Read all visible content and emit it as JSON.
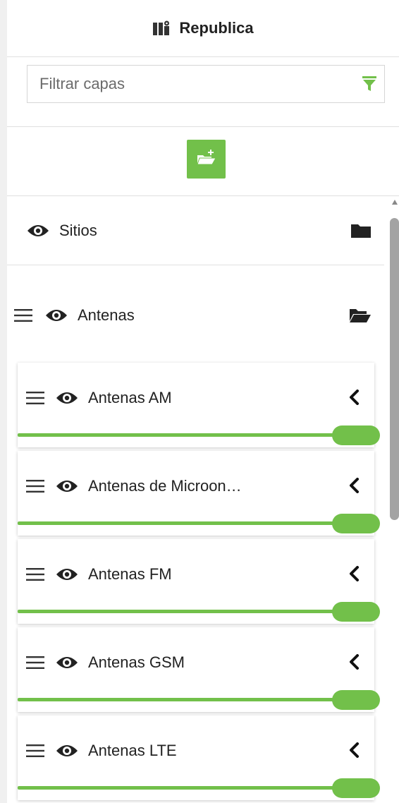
{
  "header": {
    "title": "Republica",
    "icon": "map-icon"
  },
  "filter": {
    "placeholder": "Filtrar capas",
    "icon": "filter-funnel-icon",
    "accent": "#72c04a"
  },
  "add_group": {
    "icon": "folder-plus-icon",
    "color": "#72c04a"
  },
  "groups": [
    {
      "label": "Sitios",
      "icon": "folder-closed-icon",
      "visible": true
    },
    {
      "label": "Antenas",
      "icon": "folder-open-icon",
      "visible": true
    }
  ],
  "layers": [
    {
      "label": "Antenas AM",
      "opacity": 1.0
    },
    {
      "label": "Antenas de Microon…",
      "opacity": 1.0
    },
    {
      "label": "Antenas FM",
      "opacity": 1.0
    },
    {
      "label": "Antenas GSM",
      "opacity": 1.0
    },
    {
      "label": "Antenas LTE",
      "opacity": 1.0
    }
  ]
}
